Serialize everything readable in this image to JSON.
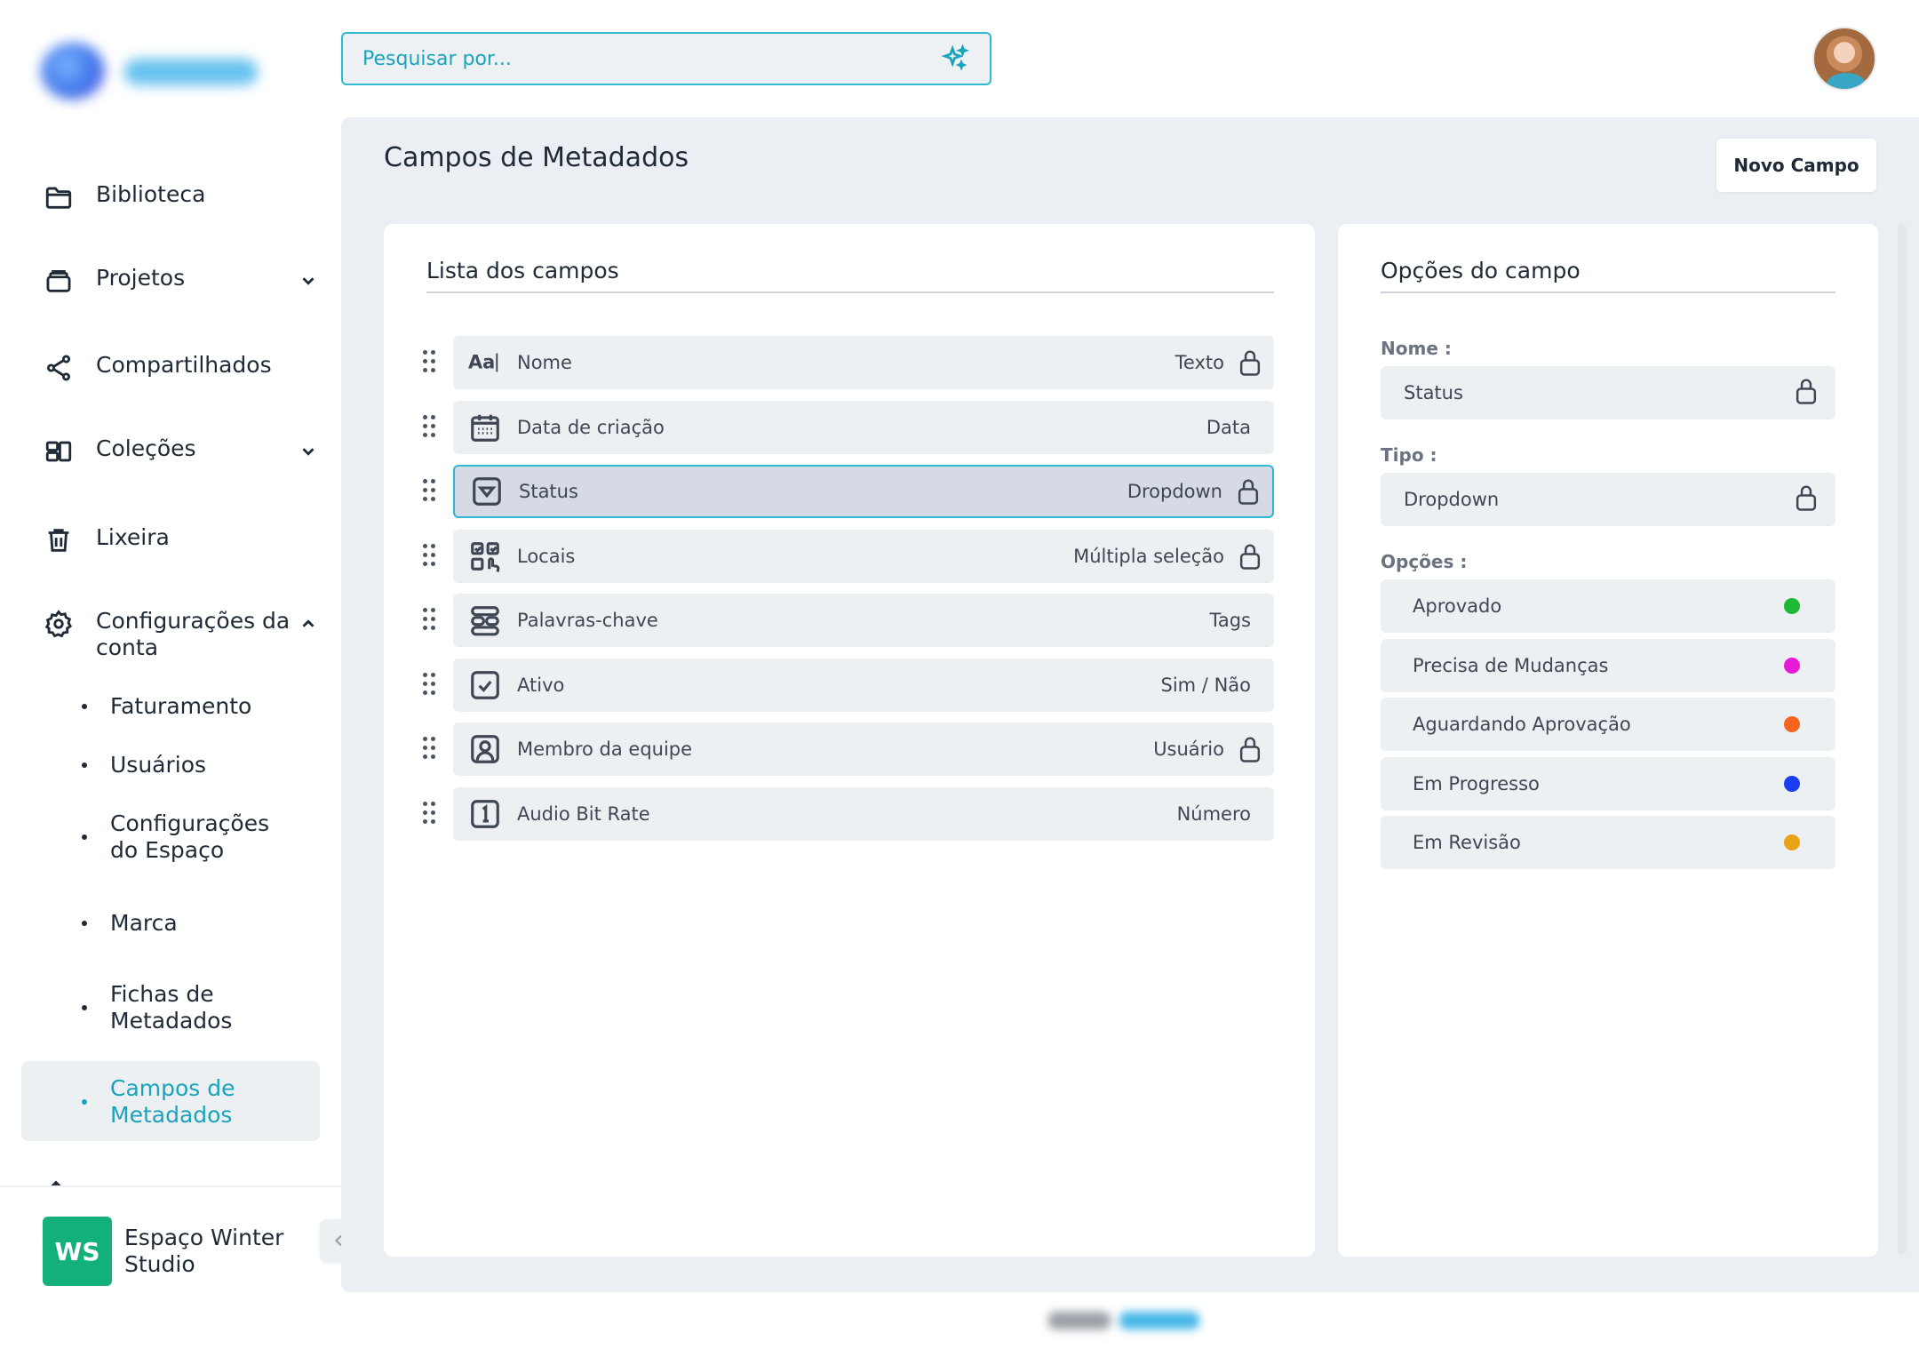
{
  "search": {
    "placeholder": "Pesquisar por..."
  },
  "sidebar": {
    "items": [
      {
        "label": "Biblioteca",
        "icon": "folder-icon"
      },
      {
        "label": "Projetos",
        "icon": "projects-icon"
      },
      {
        "label": "Compartilhados",
        "icon": "share-icon"
      },
      {
        "label": "Coleções",
        "icon": "collections-icon"
      },
      {
        "label": "Lixeira",
        "icon": "trash-icon"
      },
      {
        "label": "Configurações da conta",
        "icon": "gear-icon"
      }
    ],
    "subitems": [
      {
        "label": "Faturamento"
      },
      {
        "label": "Usuários"
      },
      {
        "label": "Configurações do Espaço"
      },
      {
        "label": "Marca"
      },
      {
        "label": "Fichas de Metadados"
      },
      {
        "label": "Campos de Metadados"
      }
    ],
    "workspace": {
      "initials": "WS",
      "name": "Espaço Winter Studio"
    }
  },
  "main": {
    "title": "Campos de Metadados",
    "new_button": "Novo Campo",
    "field_list": {
      "title": "Lista dos campos",
      "fields": [
        {
          "name": "Nome",
          "type": "Texto",
          "icon": "text-icon",
          "locked": true
        },
        {
          "name": "Data de criação",
          "type": "Data",
          "icon": "calendar-icon",
          "locked": false
        },
        {
          "name": "Status",
          "type": "Dropdown",
          "icon": "dropdown-icon",
          "locked": true
        },
        {
          "name": "Locais",
          "type": "Múltipla seleção",
          "icon": "multi-select-icon",
          "locked": true
        },
        {
          "name": "Palavras-chave",
          "type": "Tags",
          "icon": "tags-icon",
          "locked": false
        },
        {
          "name": "Ativo",
          "type": "Sim / Não",
          "icon": "checkbox-icon",
          "locked": false
        },
        {
          "name": "Membro da equipe",
          "type": "Usuário",
          "icon": "user-icon",
          "locked": true
        },
        {
          "name": "Audio Bit Rate",
          "type": "Número",
          "icon": "number-icon",
          "locked": false
        }
      ]
    },
    "field_options": {
      "title": "Opções do campo",
      "name_label": "Nome :",
      "name_value": "Status",
      "type_label": "Tipo :",
      "type_value": "Dropdown",
      "options_label": "Opções :",
      "options": [
        {
          "label": "Aprovado",
          "color": "#1db834"
        },
        {
          "label": "Precisa de Mudanças",
          "color": "#e619d6"
        },
        {
          "label": "Aguardando Aprovação",
          "color": "#f5641e"
        },
        {
          "label": "Em Progresso",
          "color": "#1a3df0"
        },
        {
          "label": "Em Revisão",
          "color": "#e8a317"
        }
      ]
    }
  },
  "colors": {
    "accent": "#1aa3bb",
    "panel": "#ebeef2",
    "workspace_badge": "#13b07a"
  }
}
